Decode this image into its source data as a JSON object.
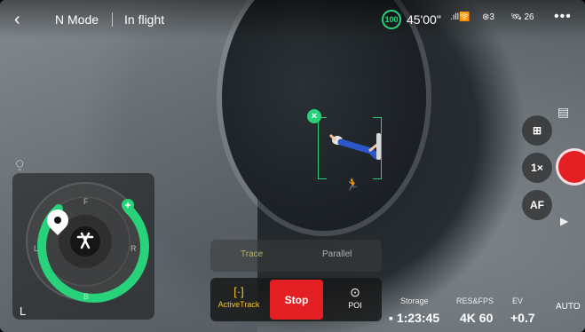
{
  "header": {
    "back_label": "‹",
    "mode_label": "N Mode",
    "status_label": "In flight",
    "battery": "100",
    "flight_time": "45'00\"",
    "signal_label": ".ıll🛜",
    "gps_label": "⊛3",
    "satellites": "26",
    "more_label": "•••"
  },
  "tracking": {
    "cancel_label": "×"
  },
  "controls": {
    "zoom_label": "1×",
    "af_label": "AF"
  },
  "nav": {
    "front_label": "F",
    "back_label": "B",
    "left_label": "L",
    "right_label": "R",
    "corner_label": "L"
  },
  "tabs": {
    "trace_label": "Trace",
    "parallel_label": "Parallel"
  },
  "actions": {
    "activetrack_label": "ActiveTrack",
    "activetrack_icon": "[·]",
    "stop_label": "Stop",
    "poi_label": "POI"
  },
  "status_bar": {
    "storage_label": "Storage",
    "storage_value": "1:23:45",
    "res_label": "RES&FPS",
    "res_value": "4K 60",
    "ev_label": "EV",
    "ev_value": "+0.7",
    "auto_label": "AUTO"
  }
}
